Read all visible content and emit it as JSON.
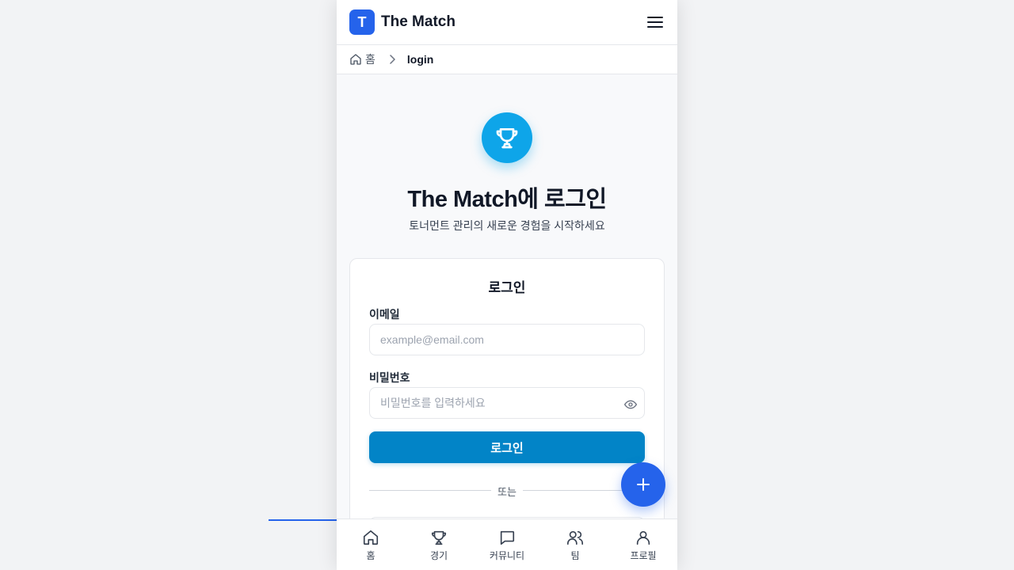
{
  "app": {
    "logo_letter": "T",
    "name": "The Match"
  },
  "breadcrumb": {
    "home": "홈",
    "current": "login"
  },
  "hero": {
    "title": "The Match에 로그인",
    "subtitle": "토너먼트 관리의 새로운 경험을 시작하세요"
  },
  "login_form": {
    "title": "로그인",
    "email_label": "이메일",
    "email_placeholder": "example@email.com",
    "email_value": "",
    "password_label": "비밀번호",
    "password_placeholder": "비밀번호를 입력하세요",
    "password_value": "",
    "submit_label": "로그인",
    "divider_text": "또는"
  },
  "bottom_nav": {
    "items": [
      {
        "label": "홈",
        "icon": "home-icon"
      },
      {
        "label": "경기",
        "icon": "trophy-icon"
      },
      {
        "label": "커뮤니티",
        "icon": "chat-icon"
      },
      {
        "label": "팀",
        "icon": "users-icon"
      },
      {
        "label": "프로필",
        "icon": "user-icon"
      }
    ]
  },
  "colors": {
    "brand": "#2563eb",
    "hero_icon": "#0ea5e9",
    "login_button": "#0284c7"
  }
}
